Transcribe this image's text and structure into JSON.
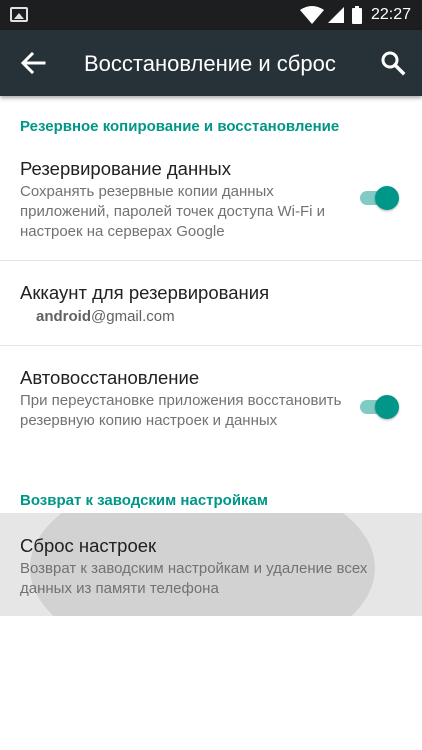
{
  "status_bar": {
    "time": "22:27",
    "icons": [
      "gallery-icon",
      "wifi-icon",
      "signal-icon",
      "battery-icon"
    ]
  },
  "toolbar": {
    "title": "Восстановление и сброс",
    "back_icon": "arrow-left-icon",
    "search_icon": "search-icon"
  },
  "sections": {
    "backup": {
      "header": "Резервное копирование и восстановление",
      "backup_data": {
        "title": "Резервирование данных",
        "summary": "Сохранять резервные копии данных приложений, паролей точек доступа Wi-Fi и настроек на серверах Google",
        "enabled": true
      },
      "backup_account": {
        "title": "Аккаунт для резервирования",
        "account_user": "android",
        "account_domain": "@gmail.com"
      },
      "auto_restore": {
        "title": "Автовосстановление",
        "summary": "При переустановке приложения восстановить резервную копию настроек и данных",
        "enabled": true
      }
    },
    "reset": {
      "header": "Возврат к заводским настройкам",
      "factory_reset": {
        "title": "Сброс настроек",
        "summary": "Возврат к заводским настройкам и удаление всех данных из памяти телефона"
      }
    }
  },
  "colors": {
    "accent": "#009688",
    "switch_track": "#80cbc4",
    "toolbar": "#263238",
    "status_bar": "#1c1e20",
    "pressed_row": "#e6e6e6"
  }
}
